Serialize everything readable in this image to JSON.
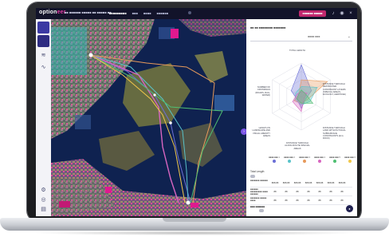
{
  "app": {
    "logo_prefix": "option",
    "logo_accent": "eer",
    "project": "■■ ■■■■■■ ■■■■■ ■■ ■■■■■ ■■",
    "tabs": [
      "■■■■■■■■■",
      "■■■",
      "■■■■",
      "■■■■■■"
    ],
    "user_button": "■■■■■■ ■■■■■",
    "top_icons": [
      "bell-icon",
      "user-icon",
      "close-icon"
    ]
  },
  "rail": {
    "tiles": [
      "",
      ""
    ],
    "icons": [
      "layers-icon",
      "trend-icon",
      "settings-icon",
      "target-icon",
      "book-icon",
      "help-icon"
    ]
  },
  "map": {
    "controls": [
      "+",
      "−",
      "⤢",
      "⤡"
    ],
    "collapse_glyph": "›"
  },
  "panel": {
    "title": "■■ ■■ ■■■■■■■■ ■■■■■■■",
    "select_value": "■■■■ ■■■",
    "radar_axes": [
      "TOTAL LENGTH",
      "DISTANCE THROUGH RESTRICTED CONSTRAINT LAYERS (SPECIAL AREAS, ECOLOGY, HERITAGE)",
      "DISTANCE THROUGH LAND WITH PHYSICAL SUBSURFACE CONSTRAINTS (E.G. ROCK)",
      "DISTANCE THROUGH ALONG ROUTE SPECIAL AREAS",
      "LENGTH IN LANDSCAPE AND VISUAL AMENITY AREAS",
      "NUMBER OF CROSSINGS (ROADS, RAIL, WATER)"
    ],
    "legend": [
      {
        "label": "■■■■ ■■■ 1",
        "color": "#6b6fd6"
      },
      {
        "label": "■■■■ ■■■ 2",
        "color": "#59c3c9"
      },
      {
        "label": "■■■■ ■■■ 3",
        "color": "#e79a5b"
      },
      {
        "label": "■■■■ ■■■ 4",
        "color": "#d765c0"
      },
      {
        "label": "■■■■ ■■■ 5",
        "color": "#4fbf72"
      },
      {
        "label": "■■■■ ■■■ 6",
        "color": "#f0c74a"
      },
      {
        "label": "■■■■ ■■■ 7",
        "color": "#8e8e8e"
      }
    ],
    "section1": "Total Length",
    "rows": [
      {
        "label": "■■■■■■■ ■■■■■■",
        "cells": [
          "888.88",
          "888.88",
          "888.88",
          "888.88",
          "888.88",
          "888.88",
          "888.88"
        ]
      },
      {
        "label": "■■■■■■ ■■■■■■■■■ ■■■■ ■■■■■■",
        "cells": [
          "88",
          "88",
          "88",
          "88",
          "88",
          "88",
          "88"
        ]
      },
      {
        "label": "■■■■■■■ ■■■■■ ■■■■",
        "cells": [
          "88",
          "88",
          "88",
          "88",
          "88",
          "88",
          "88"
        ]
      }
    ],
    "section2": "■■■ ■■■■■■",
    "rows2": [
      {
        "label": "■■■■■■■■ ■■■■■■■ ■■■■ ■■■■■■",
        "cells": [
          "888",
          "888",
          "888",
          "888",
          "888",
          "888",
          "888"
        ]
      },
      {
        "label": "■■■■ ■■■■ ■■■■",
        "cells": [
          "888",
          "888",
          "888",
          "888",
          "888",
          "888",
          "888"
        ]
      }
    ],
    "fab_glyph": "●"
  }
}
